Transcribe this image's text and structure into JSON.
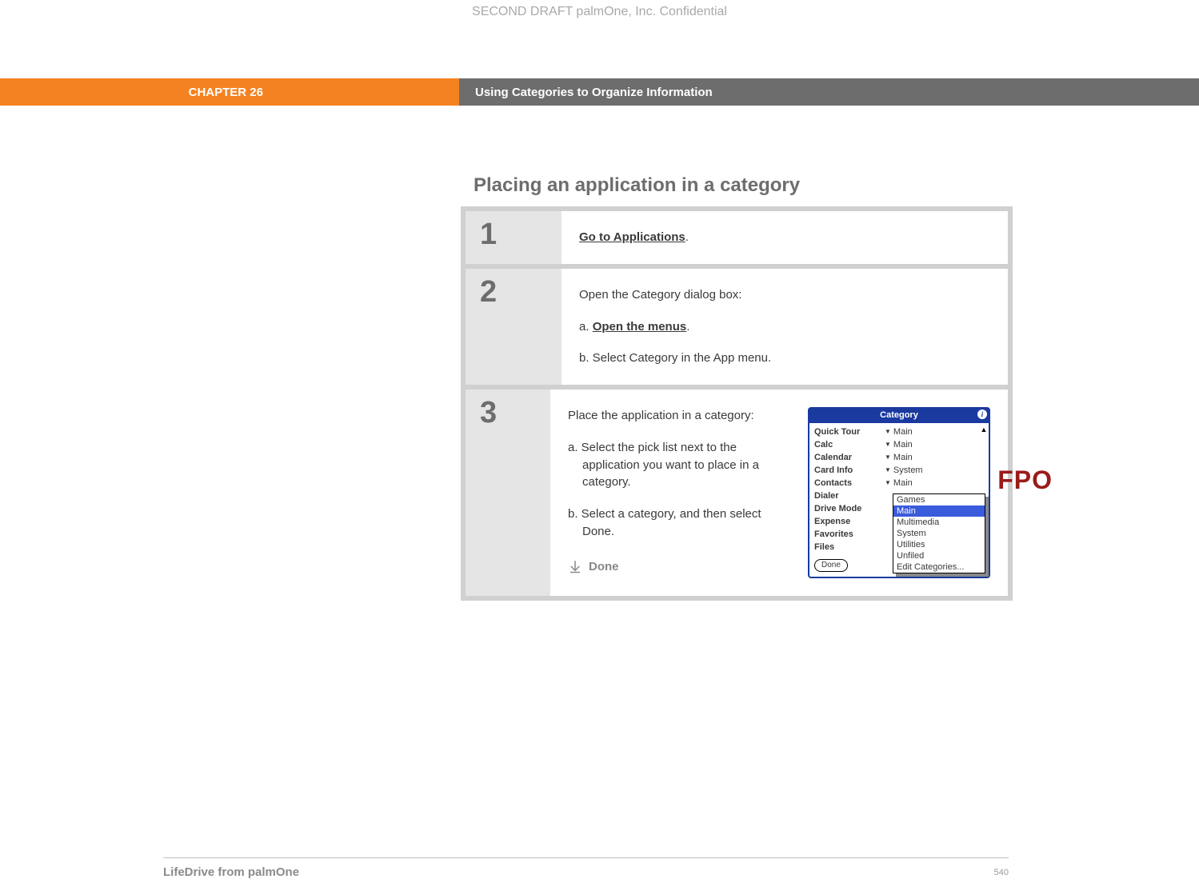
{
  "confidential": "SECOND DRAFT palmOne, Inc.  Confidential",
  "chapter": "CHAPTER 26",
  "chapter_title": "Using Categories to Organize Information",
  "section_title": "Placing an application in a category",
  "steps": {
    "s1": {
      "num": "1",
      "link": "Go to Applications",
      "period": "."
    },
    "s2": {
      "num": "2",
      "intro": "Open the Category dialog box:",
      "a_prefix": "a.  ",
      "a_link": "Open the menus",
      "a_period": ".",
      "b": "b.  Select Category in the App menu."
    },
    "s3": {
      "num": "3",
      "intro": "Place the application in a category:",
      "a": "a.  Select the pick list next to the application you want to place in a category.",
      "b": "b.  Select a category, and then select Done.",
      "done": "Done"
    }
  },
  "fpo": "FPO",
  "palm": {
    "title": "Category",
    "info": "i",
    "apps": [
      "Quick Tour",
      "Calc",
      "Calendar",
      "Card Info",
      "Contacts",
      "Dialer",
      "Drive Mode",
      "Expense",
      "Favorites",
      "Files"
    ],
    "cats": [
      "Main",
      "Main",
      "Main",
      "System",
      "Main"
    ],
    "dd": [
      "Games",
      "Main",
      "Multimedia",
      "System",
      "Utilities",
      "Unfiled",
      "Edit Categories..."
    ],
    "done": "Done"
  },
  "footer_left": "LifeDrive from palmOne",
  "footer_right": "540"
}
